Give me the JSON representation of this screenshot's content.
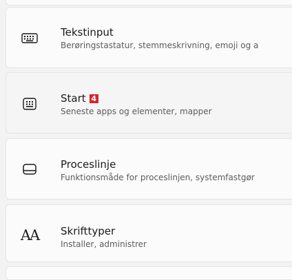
{
  "settings": [
    {
      "icon": "keyboard-icon",
      "title": "Tekstinput",
      "subtitle": "Berøringstastatur, stemmeskrivning, emoji og a"
    },
    {
      "icon": "start-menu-icon",
      "title": "Start",
      "badge": "4",
      "subtitle": "Seneste apps og elementer, mapper"
    },
    {
      "icon": "taskbar-icon",
      "title": "Proceslinje",
      "subtitle": "Funktionsmåde for proceslinjen, systemfastgør"
    },
    {
      "icon": "fonts-icon",
      "icon_glyph": "AA",
      "title": "Skrifttyper",
      "subtitle": "Installer, administrer"
    }
  ],
  "colors": {
    "badge": "#d9232e",
    "background": "#f3f3f3",
    "card": "#fbfbfb"
  }
}
